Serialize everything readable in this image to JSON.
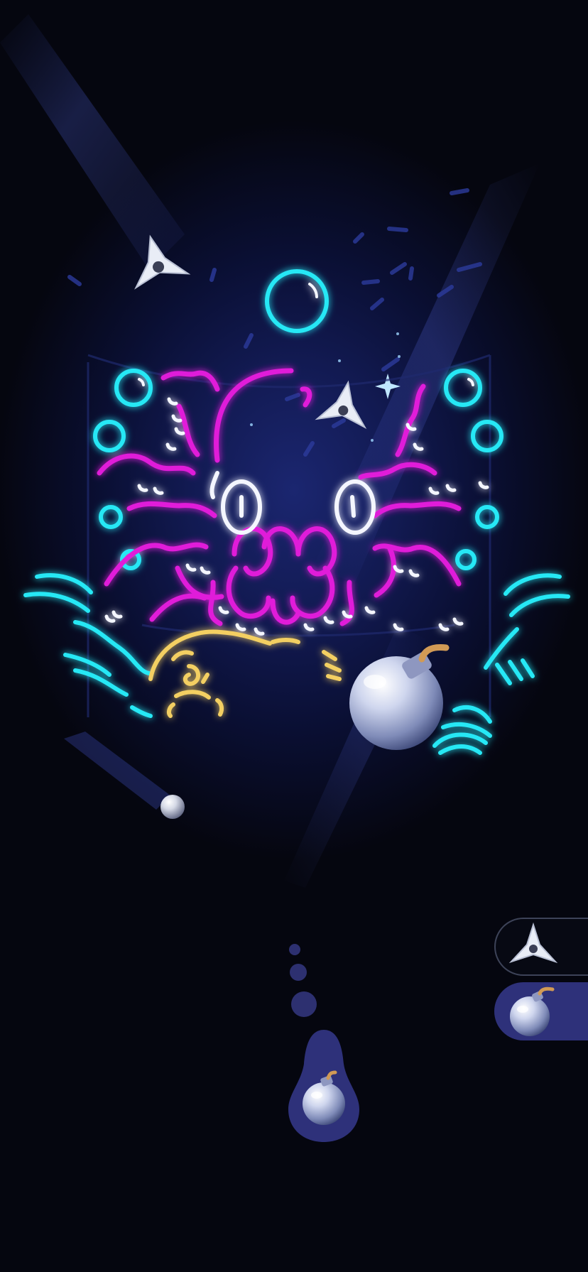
{
  "game": {
    "scene": "neon-octopus-level",
    "colors": {
      "background": "#05060f",
      "glow": "#1b2670",
      "neon_cyan": "#27e8f5",
      "neon_magenta": "#e01bd9",
      "neon_white": "#f4f6ff",
      "neon_yellow": "#f3cf62",
      "selected_slot": "#2e317a"
    }
  },
  "weapons": {
    "items": [
      {
        "icon": "shuriken-icon",
        "selected": false
      },
      {
        "icon": "bomb-icon",
        "selected": true
      }
    ]
  },
  "launcher": {
    "loaded": "bomb-icon",
    "aim_dots": 3
  }
}
